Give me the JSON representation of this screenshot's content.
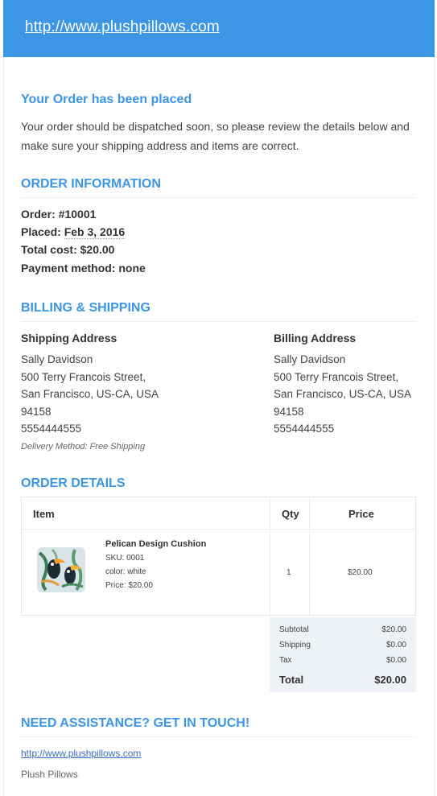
{
  "header": {
    "site_link": "http://www.plushpillows.com"
  },
  "intro": {
    "title": "Your Order has been placed",
    "message": "Your order should be dispatched soon, so please review the details below and make sure your shipping address and items are correct."
  },
  "order_info": {
    "heading": "ORDER INFORMATION",
    "order_label": "Order:",
    "order_value": "#10001",
    "placed_label": "Placed:",
    "placed_value": "Feb 3, 2016",
    "total_label": "Total cost:",
    "total_value": "$20.00",
    "payment_label": "Payment method:",
    "payment_value": "none"
  },
  "billing_shipping": {
    "heading": "BILLING & SHIPPING",
    "shipping": {
      "title": "Shipping Address",
      "lines": [
        "Sally Davidson",
        "500 Terry Francois Street,",
        "San Francisco, US-CA, USA",
        "94158",
        "5554444555"
      ]
    },
    "billing": {
      "title": "Billing Address",
      "lines": [
        "Sally Davidson",
        "500 Terry Francois Street,",
        "San Francisco, US-CA, USA",
        "94158",
        "5554444555"
      ]
    },
    "delivery_method": "Delivery Method: Free Shipping"
  },
  "order_details": {
    "heading": "ORDER DETAILS",
    "columns": [
      "Item",
      "Qty",
      "Price"
    ],
    "item": {
      "name": "Pelican Design Cushion",
      "sku": "SKU: 0001",
      "color": "color: white",
      "price_line": "Price: $20.00",
      "qty": "1",
      "price": "$20.00"
    },
    "totals": {
      "subtotal_label": "Subtotal",
      "subtotal": "$20.00",
      "shipping_label": "Shipping",
      "shipping": "$0.00",
      "tax_label": "Tax",
      "tax": "$0.00",
      "total_label": "Total",
      "total": "$20.00"
    }
  },
  "assistance": {
    "heading": "NEED ASSISTANCE? GET IN TOUCH!",
    "link": "http://www.plushpillows.com",
    "name": "Plush Pillows"
  },
  "colors": {
    "accent": "#3d95e6",
    "totals_bg": "#eef1f5"
  }
}
